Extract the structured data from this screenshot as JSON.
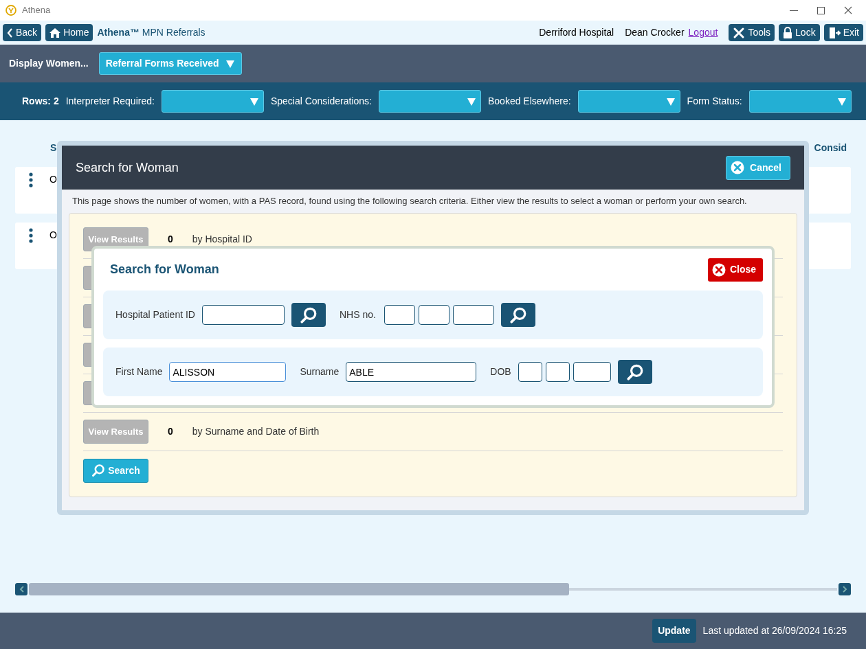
{
  "window": {
    "title": "Athena"
  },
  "toolbar": {
    "back": "Back",
    "home": "Home",
    "app_name": "**Athena™** MPN Referrals",
    "hospital": "Derriford Hospital",
    "user": "Dean Crocker",
    "logout": "Logout",
    "buttons": [
      {
        "label": "Tools",
        "kind": "tools"
      },
      {
        "label": "Lock",
        "kind": "lock"
      },
      {
        "label": "Exit",
        "kind": "exit"
      }
    ]
  },
  "display_bar": {
    "label": "Display Women...",
    "dropdown": "Referral Forms Received"
  },
  "filter_bar": {
    "rows": "Rows: 2",
    "filters": [
      {
        "label": "Interpreter Required:"
      },
      {
        "label": "Special Considerations:"
      },
      {
        "label": "Booked Elsewhere:"
      },
      {
        "label": "Form Status:"
      }
    ]
  },
  "table": {
    "columns": [
      "S",
      "Consid"
    ],
    "rows": [
      {
        "cell": "O"
      },
      {
        "cell": "O"
      }
    ]
  },
  "search_dialog": {
    "title": "Search for Woman",
    "cancel": "Cancel",
    "description": "This page shows the number of women, with a PAS record, found using the following search criteria. Either view the results to select a woman or perform your own search.",
    "results": [
      {
        "kind": "full",
        "button": "View Results",
        "disabled": true,
        "count": "0",
        "label": "by Hospital ID"
      },
      {
        "kind": "covered",
        "disabled": true
      },
      {
        "kind": "covered",
        "disabled": true
      },
      {
        "kind": "covered",
        "disabled": true
      },
      {
        "kind": "covered",
        "disabled": true
      },
      {
        "kind": "full",
        "button": "View Results",
        "disabled": true,
        "count": "0",
        "label": "by Surname and Date of Birth"
      }
    ],
    "search_button": "Search"
  },
  "inner_dialog": {
    "title": "Search for Woman",
    "close": "Close",
    "hospital_id": {
      "label": "Hospital Patient ID"
    },
    "nhs": {
      "label": "NHS no.",
      "parts": [
        {
          "kind": "narrow"
        },
        {
          "kind": "narrow"
        },
        {
          "kind": "wide"
        }
      ]
    },
    "first_name": {
      "label": "First Name",
      "value": "ALISSON"
    },
    "surname": {
      "label": "Surname",
      "value": "ABLE"
    },
    "dob": {
      "label": "DOB",
      "parts": [
        {
          "kind": "narrow"
        },
        {
          "kind": "narrow"
        },
        {
          "kind": "wide"
        }
      ]
    }
  },
  "footer": {
    "update": "Update",
    "last_updated": "Last updated at 26/09/2024 16:25"
  }
}
